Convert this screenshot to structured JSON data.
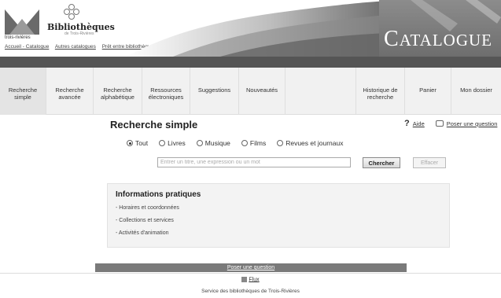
{
  "header": {
    "logo_caption": "trois-rivières",
    "bib_title": "Bibliothèques",
    "bib_subtitle": "de Trois-Rivières",
    "top_links": [
      "Accueil - Catalogue",
      "Autres catalogues",
      "Prêt entre bibliothèques"
    ],
    "catalogue_first": "C",
    "catalogue_rest": "ATALOGUE"
  },
  "nav": {
    "items": [
      {
        "label": "Recherche simple",
        "active": true
      },
      {
        "label": "Recherche avancée"
      },
      {
        "label": "Recherche alphabétique"
      },
      {
        "label": "Ressources électroniques"
      },
      {
        "label": "Suggestions"
      },
      {
        "label": "Nouveautés"
      },
      {
        "label": "Historique de recherche"
      },
      {
        "label": "Panier"
      },
      {
        "label": "Mon dossier"
      }
    ]
  },
  "main": {
    "title": "Recherche simple",
    "help_label": "Aide",
    "ask_label": "Poser une question",
    "filters": [
      {
        "label": "Tout",
        "selected": true
      },
      {
        "label": "Livres"
      },
      {
        "label": "Musique"
      },
      {
        "label": "Films"
      },
      {
        "label": "Revues et journaux"
      }
    ],
    "search_placeholder": "Entrer un titre, une expression ou un mot",
    "search_button": "Chercher",
    "clear_button": "Effacer"
  },
  "info": {
    "title": "Informations pratiques",
    "links": [
      "- Horaires et coordonnées",
      "- Collections et services",
      "- Activités d'animation"
    ]
  },
  "footer": {
    "ask_link": "Poser une question",
    "feed_label": "Flux",
    "service": "Service des bibliothèques de Trois-Rivières"
  }
}
